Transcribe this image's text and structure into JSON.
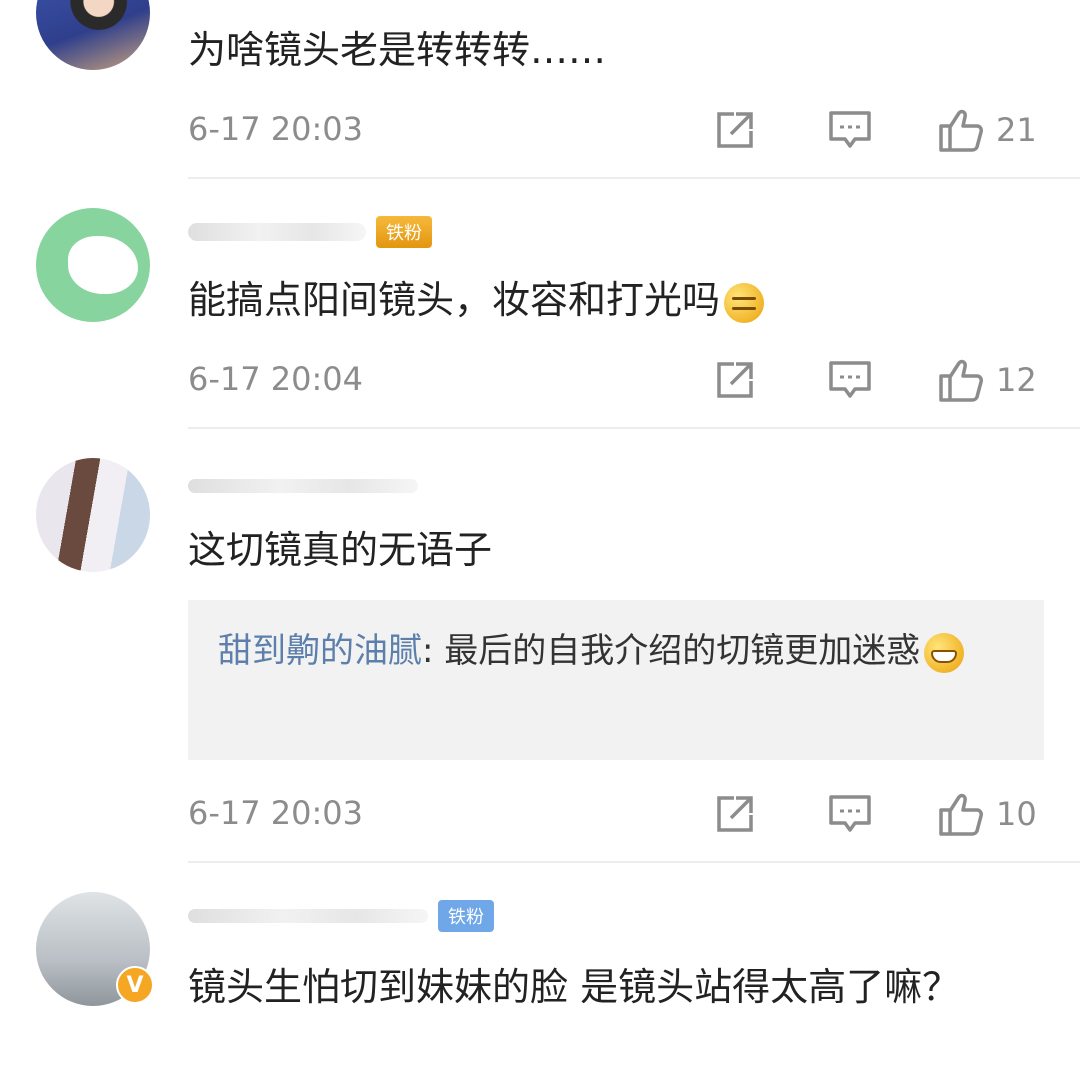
{
  "comments": [
    {
      "text": "为啥镜头老是转转转……",
      "time": "6-17 20:03",
      "likes": "21"
    },
    {
      "badge": "铁粉",
      "text": "能搞点阳间镜头，妆容和打光吗",
      "emoji": "smirking-emoji",
      "time": "6-17 20:04",
      "likes": "12"
    },
    {
      "text": "这切镜真的无语子",
      "reply": {
        "name": "甜到齁的油腻",
        "separator": ":",
        "text": " 最后的自我介绍的切镜更加迷惑",
        "emoji": "grinning-emoji"
      },
      "time": "6-17 20:03",
      "likes": "10"
    },
    {
      "badge": "铁粉",
      "verified": "V",
      "text": "镜头生怕切到妹妹的脸 是镜头站得太高了嘛？"
    }
  ],
  "colors": {
    "text": "#222222",
    "meta": "#8c8c8c",
    "reply_name": "#5d7fab",
    "quote_bg": "#f2f2f2",
    "badge_gold": "#e39610",
    "badge_blue": "#6fa7e8",
    "verified": "#f5a623"
  },
  "icons": [
    "share-icon",
    "comment-icon",
    "like-icon"
  ]
}
